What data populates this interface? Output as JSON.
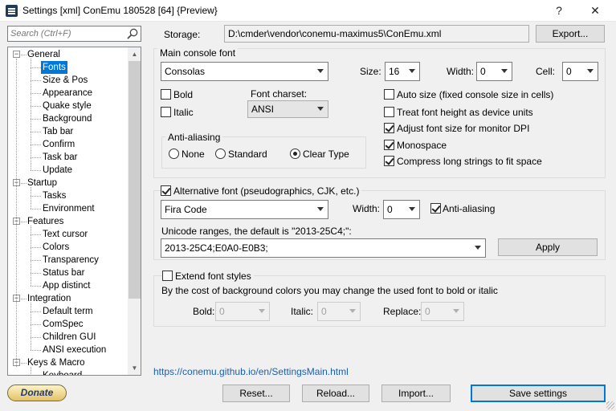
{
  "window": {
    "title": "Settings [xml] ConEmu 180528 [64] {Preview}",
    "help_glyph": "?",
    "close_glyph": "✕"
  },
  "search": {
    "placeholder": "Search (Ctrl+F)"
  },
  "tree": {
    "expander_glyph": "−",
    "groups": [
      {
        "label": "General",
        "items": [
          "Fonts",
          "Size & Pos",
          "Appearance",
          "Quake style",
          "Background",
          "Tab bar",
          "Confirm",
          "Task bar",
          "Update"
        ]
      },
      {
        "label": "Startup",
        "items": [
          "Tasks",
          "Environment"
        ]
      },
      {
        "label": "Features",
        "items": [
          "Text cursor",
          "Colors",
          "Transparency",
          "Status bar",
          "App distinct"
        ]
      },
      {
        "label": "Integration",
        "items": [
          "Default term",
          "ComSpec",
          "Children GUI",
          "ANSI execution"
        ]
      },
      {
        "label": "Keys & Macro",
        "items": [
          "Keyboard"
        ]
      }
    ],
    "selected": "Fonts"
  },
  "storage": {
    "label": "Storage:",
    "path": "D:\\cmder\\vendor\\conemu-maximus5\\ConEmu.xml",
    "export_label": "Export..."
  },
  "main_font": {
    "group_label": "Main console font",
    "font_name": "Consolas",
    "size_label": "Size:",
    "size_value": "16",
    "width_label": "Width:",
    "width_value": "0",
    "cell_label": "Cell:",
    "cell_value": "0",
    "bold_label": "Bold",
    "bold_checked": false,
    "italic_label": "Italic",
    "italic_checked": false,
    "charset_label": "Font charset:",
    "charset_value": "ANSI",
    "antialias": {
      "label": "Anti-aliasing",
      "options": [
        "None",
        "Standard",
        "Clear Type"
      ],
      "selected": "Clear Type"
    },
    "options": [
      {
        "label": "Auto size (fixed console size in cells)",
        "checked": false
      },
      {
        "label": "Treat font height as device units",
        "checked": false
      },
      {
        "label": "Adjust font size for monitor DPI",
        "checked": true
      },
      {
        "label": "Monospace",
        "checked": true
      },
      {
        "label": "Compress long strings to fit space",
        "checked": true
      }
    ]
  },
  "alt_font": {
    "enable_label": "Alternative font (pseudographics, CJK, etc.)",
    "enabled": true,
    "font_name": "Fira Code",
    "width_label": "Width:",
    "width_value": "0",
    "antialias_label": "Anti-aliasing",
    "antialias_checked": true,
    "unicode_label": "Unicode ranges, the default is \"2013-25C4;\":",
    "unicode_value": "2013-25C4;E0A0-E0B3;",
    "apply_label": "Apply"
  },
  "extend_styles": {
    "enable_label": "Extend font styles",
    "enabled": false,
    "description": "By the cost of background colors you may change the used font to bold or italic",
    "bold_label": "Bold:",
    "bold_value": "0",
    "italic_label": "Italic:",
    "italic_value": "0",
    "replace_label": "Replace:",
    "replace_value": "0"
  },
  "footer": {
    "help_link": "https://conemu.github.io/en/SettingsMain.html",
    "donate_label": "Donate",
    "reset_label": "Reset...",
    "reload_label": "Reload...",
    "import_label": "Import...",
    "save_label": "Save settings"
  },
  "colors": {
    "selection": "#0078d7",
    "link": "#1a5fb4",
    "window_bg": "#f0f0f0"
  }
}
